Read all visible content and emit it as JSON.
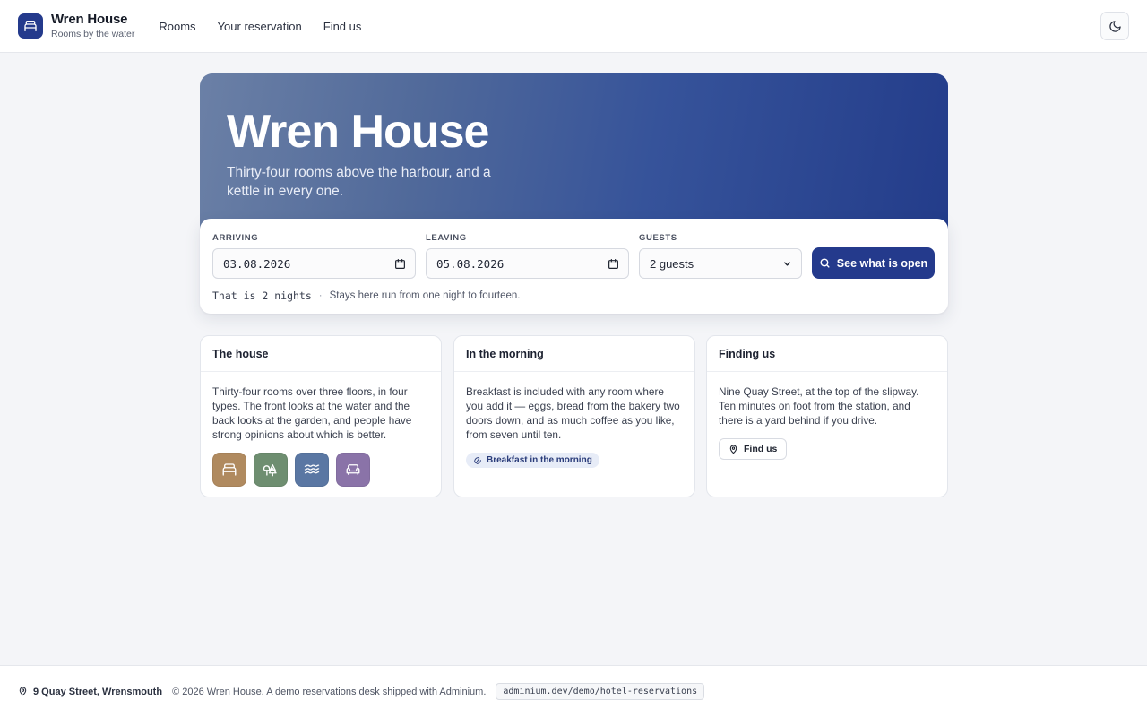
{
  "header": {
    "brand_name": "Wren House",
    "brand_tagline": "Rooms by the water",
    "nav": [
      {
        "label": "Rooms"
      },
      {
        "label": "Your reservation"
      },
      {
        "label": "Find us"
      }
    ],
    "brand_icon": "bed-icon",
    "theme_icon": "moon-icon"
  },
  "hero": {
    "title": "Wren House",
    "subtitle": "Thirty-four rooms above the harbour, and a kettle in every one."
  },
  "search": {
    "arriving_label": "ARRIVING",
    "arriving_value": "03.08.2026",
    "leaving_label": "LEAVING",
    "leaving_value": "05.08.2026",
    "guests_label": "GUESTS",
    "guests_value": "2 guests",
    "submit_label": "See what is open",
    "nights_text": "That is 2 nights",
    "separator": "·",
    "stay_note": "Stays here run from one night to fourteen."
  },
  "cards": {
    "house": {
      "title": "The house",
      "body": "Thirty-four rooms over three floors, in four types. The front looks at the water and the back looks at the garden, and people have strong opinions about which is better.",
      "room_icons": [
        {
          "name": "bed-icon",
          "color": "#b08a5f"
        },
        {
          "name": "trees-icon",
          "color": "#6e8e70"
        },
        {
          "name": "waves-icon",
          "color": "#5a77a3"
        },
        {
          "name": "sofa-icon",
          "color": "#8a73a8"
        }
      ]
    },
    "morning": {
      "title": "In the morning",
      "body": "Breakfast is included with any room where you add it — eggs, bread from the bakery two doors down, and as much coffee as you like, from seven until ten.",
      "chip_label": "Breakfast in the morning"
    },
    "finding": {
      "title": "Finding us",
      "body": "Nine Quay Street, at the top of the slipway. Ten minutes on foot from the station, and there is a yard behind if you drive.",
      "button_label": "Find us"
    }
  },
  "footer": {
    "address": "9 Quay Street, Wrensmouth",
    "copyright": "© 2026 Wren House. A demo reservations desk shipped with Adminium.",
    "url": "adminium.dev/demo/hotel-reservations"
  },
  "colors": {
    "accent": "#243a8c",
    "background": "#f4f5f8"
  }
}
